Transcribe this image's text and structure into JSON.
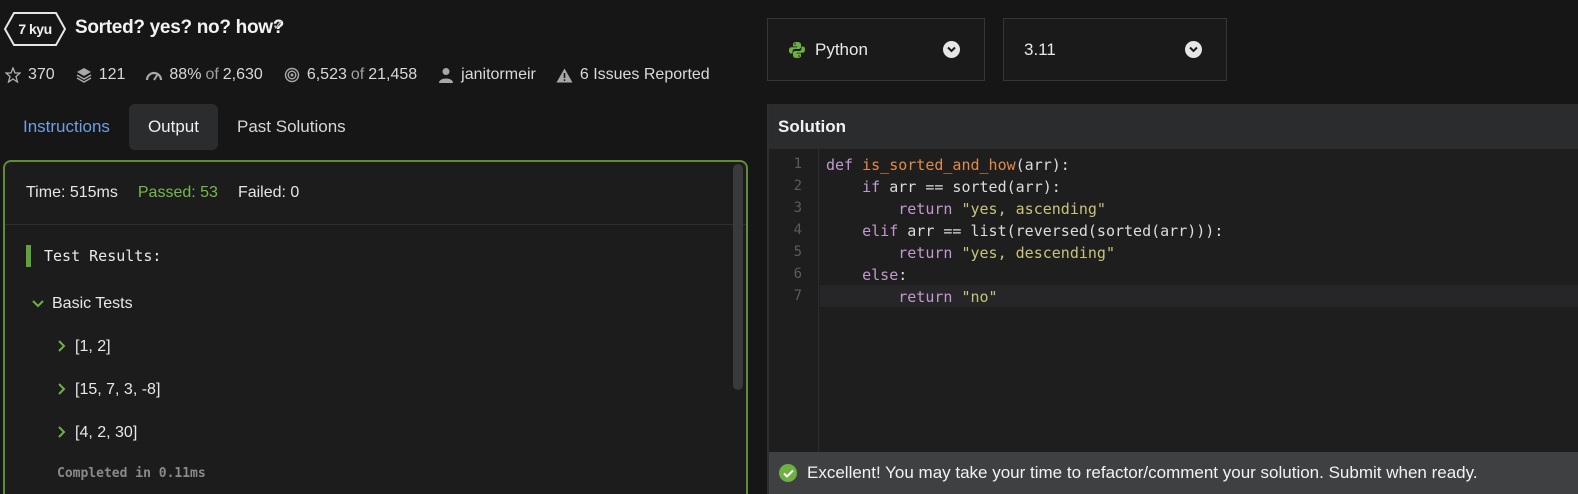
{
  "kata": {
    "rank": "7 kyu",
    "title": "Sorted? yes? no? how?"
  },
  "stats": {
    "stars": "370",
    "collections": "121",
    "satisfaction_pct": "88%",
    "of_label": "of",
    "satisfaction_votes": "2,630",
    "completed": "6,523",
    "attempted": "21,458",
    "author": "janitormeir",
    "issues": "6 Issues Reported"
  },
  "tabs": [
    "Instructions",
    "Output",
    "Past Solutions"
  ],
  "output": {
    "time": "Time: 515ms",
    "passed": "Passed: 53",
    "failed": "Failed: 0",
    "results_label": "Test Results:",
    "group": "Basic Tests",
    "tests": [
      "[1, 2]",
      "[15, 7, 3, -8]",
      "[4, 2, 30]"
    ],
    "completed": "Completed in 0.11ms"
  },
  "language_select": {
    "value": "Python",
    "icon": "python-logo-icon"
  },
  "version_select": {
    "value": "3.11"
  },
  "editor": {
    "title": "Solution",
    "line_numbers": [
      "1",
      "2",
      "3",
      "4",
      "5",
      "6",
      "7"
    ],
    "code": {
      "l1_def": "def ",
      "l1_fn": "is_sorted_and_how",
      "l1_rest": "(arr):",
      "l2_indent": "    ",
      "l2_kw": "if",
      "l2_rest": " arr == sorted(arr):",
      "l3_indent": "        ",
      "l3_kw": "return",
      "l3_str": " \"yes, ascending\"",
      "l4_indent": "    ",
      "l4_kw": "elif",
      "l4_rest": " arr == list(reversed(sorted(arr))):",
      "l5_indent": "        ",
      "l5_kw": "return",
      "l5_str": " \"yes, descending\"",
      "l6_indent": "    ",
      "l6_kw": "else",
      "l6_rest": ":",
      "l7_indent": "        ",
      "l7_kw": "return",
      "l7_str": " \"no\""
    },
    "status": "Excellent! You may take your time to refactor/comment your solution. Submit when ready."
  },
  "colors": {
    "accent_green": "#6fb043",
    "link_blue": "#6e9fe0",
    "keyword": "#c299cf",
    "function": "#e08a4b",
    "string": "#c7c47a"
  }
}
